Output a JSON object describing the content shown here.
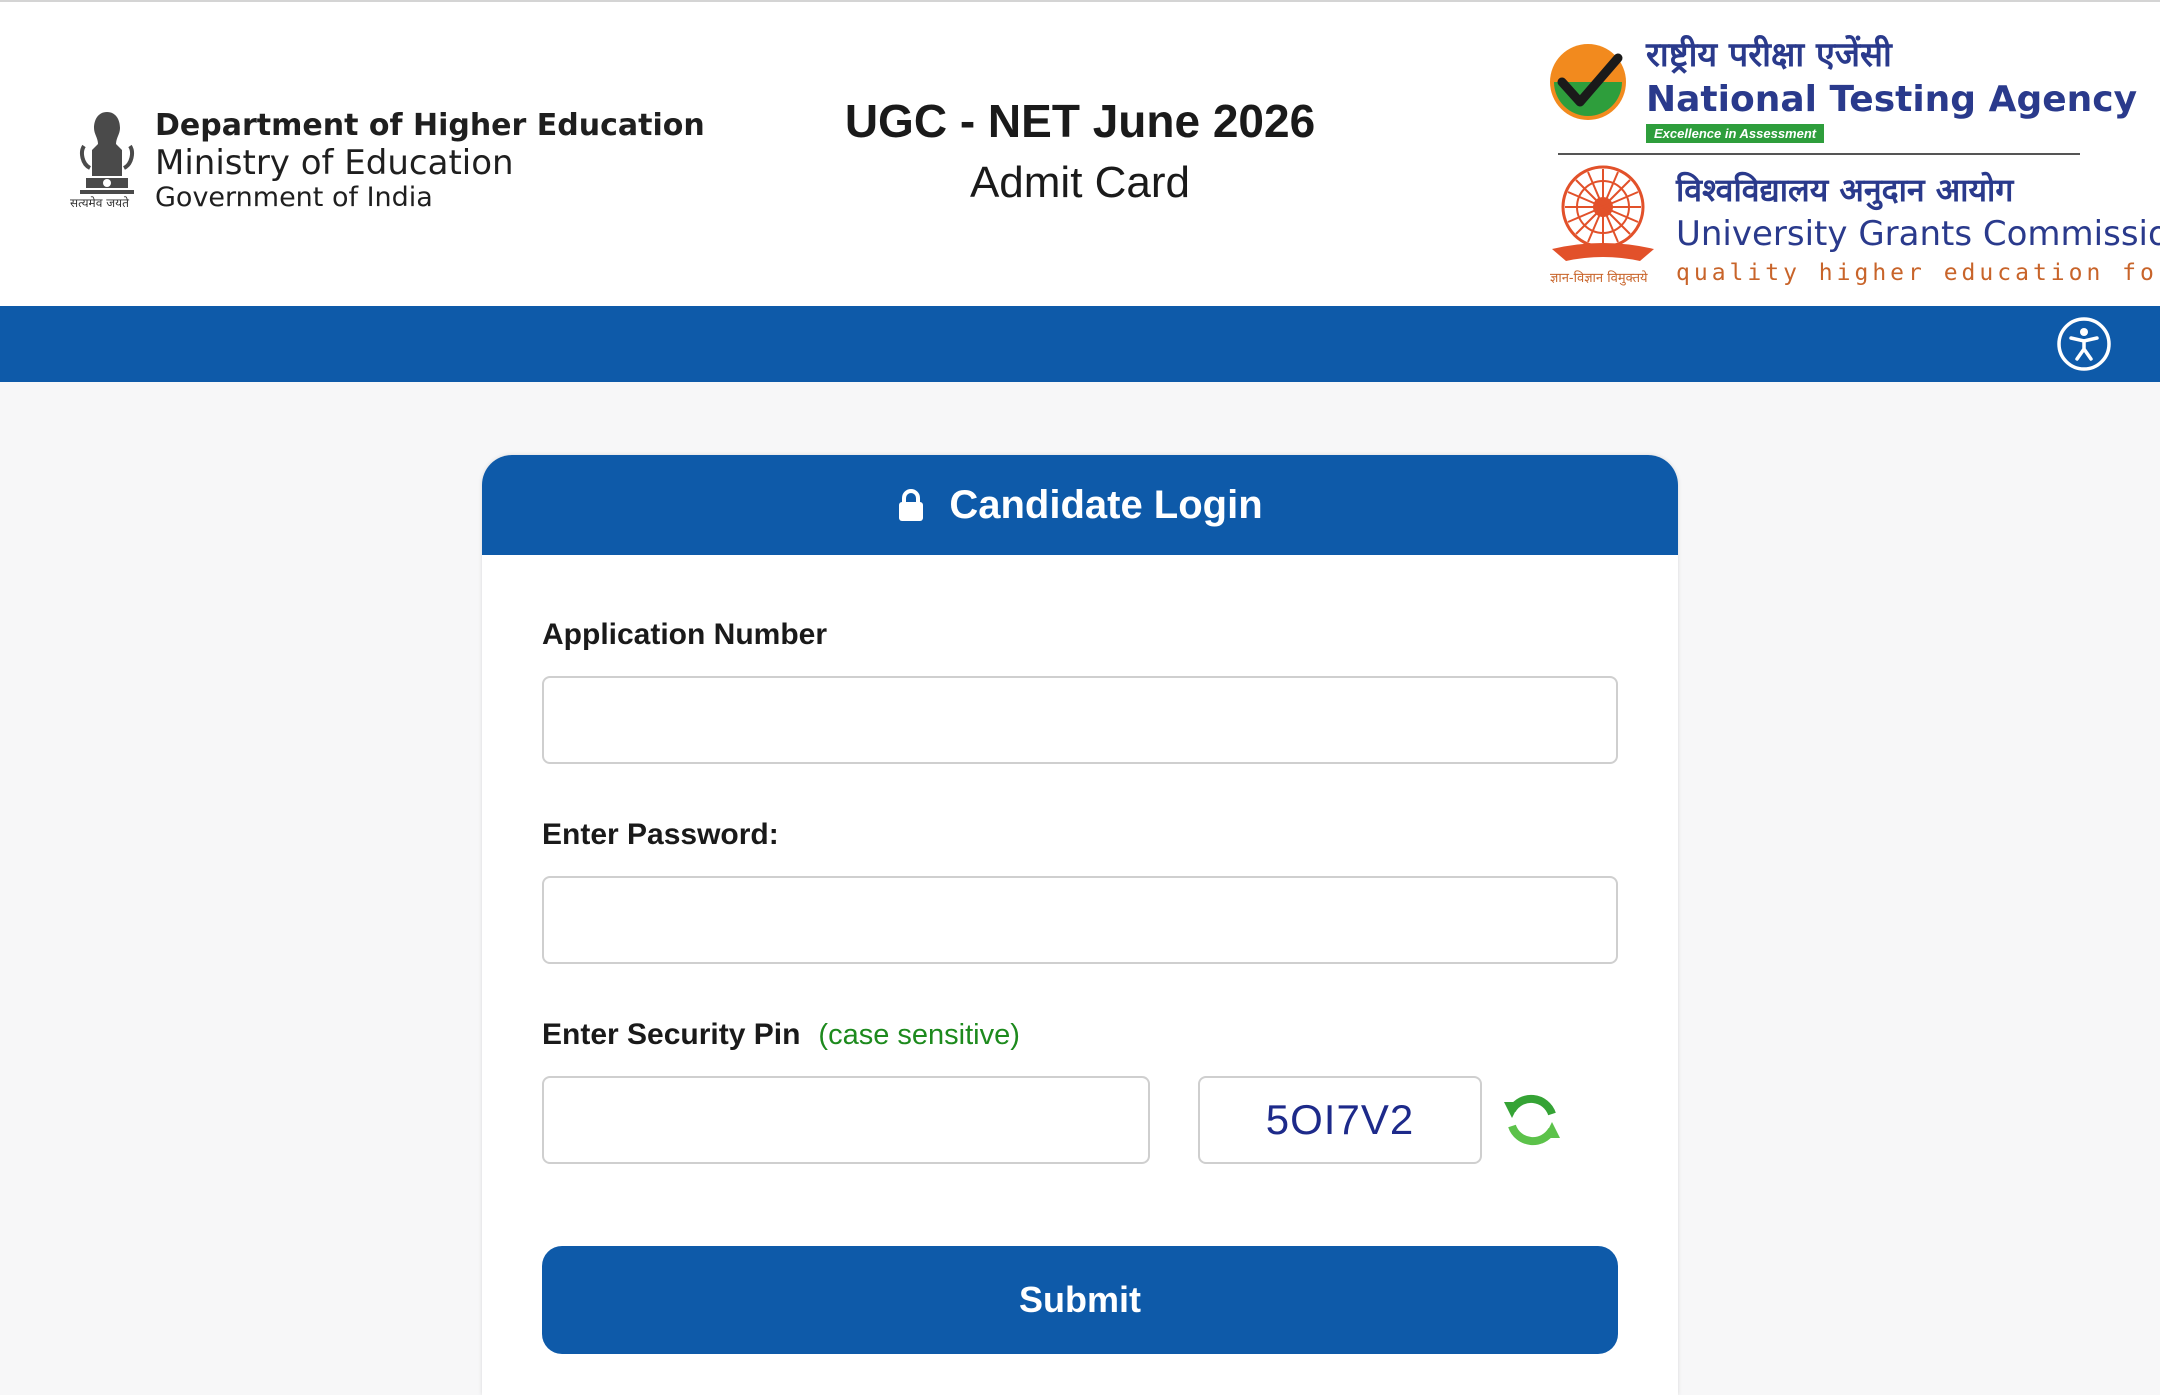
{
  "header": {
    "department": {
      "line1": "Department of Higher Education",
      "line2": "Ministry of Education",
      "line3": "Government of India",
      "emblem_motto": "सत्यमेव जयते"
    },
    "title": "UGC - NET June 2026",
    "subtitle": "Admit Card",
    "nta": {
      "hindi": "राष्ट्रीय परीक्षा एजेंसी",
      "english": "National Testing Agency",
      "tagline": "Excellence in Assessment"
    },
    "ugc": {
      "hindi": "विश्वविद्यालय अनुदान आयोग",
      "english": "University Grants Commission",
      "tagline": "quality higher education for all",
      "emblem_motto": "ज्ञान-विज्ञान विमुक्तये"
    }
  },
  "toolbar": {
    "accessibility_icon": "accessibility-icon"
  },
  "login": {
    "title": "Candidate Login",
    "lock_icon": "lock-icon",
    "application_number_label": "Application Number",
    "application_number_value": "",
    "password_label": "Enter Password:",
    "password_value": "",
    "security_pin_label": "Enter Security Pin",
    "security_pin_hint": "(case sensitive)",
    "security_pin_value": "",
    "captcha_text": "5OI7V2",
    "refresh_icon": "refresh-icon",
    "submit_label": "Submit"
  },
  "colors": {
    "primary": "#0e5aa9",
    "hint_green": "#1d8a1d",
    "captcha_text": "#1d2a8a",
    "nta_blue": "#2a3a8c",
    "ugc_orange": "#c8642a"
  }
}
